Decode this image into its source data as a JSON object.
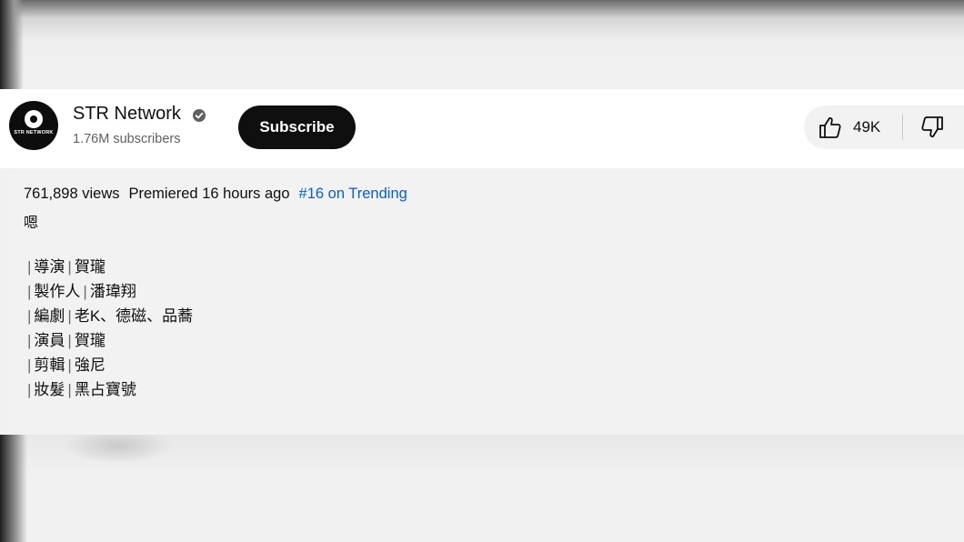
{
  "channel": {
    "name": "STR Network",
    "subscribers": "1.76M subscribers",
    "avatar_text": "STR NETWORK"
  },
  "subscribe_label": "Subscribe",
  "likes": {
    "count": "49K"
  },
  "description": {
    "views": "761,898 views",
    "premiered": "Premiered 16 hours ago",
    "trending": "#16 on Trending",
    "first_line": "嗯",
    "credits": [
      {
        "role": "導演",
        "name": "賀瓏"
      },
      {
        "role": "製作人",
        "name": "潘瑋翔"
      },
      {
        "role": "編劇",
        "name": "老K、德磁、品蕎"
      },
      {
        "role": "演員",
        "name": "賀瓏"
      },
      {
        "role": "剪輯",
        "name": "強尼"
      },
      {
        "role": "妝髮",
        "name": "黑占寶號"
      }
    ]
  },
  "colors": {
    "link": "#065fd4",
    "subscribe_bg": "#0f0f0f",
    "panel_bg": "#f2f2f2"
  },
  "icons": {
    "verified": "check-circle",
    "like": "thumbs-up-outline",
    "dislike": "thumbs-down-outline"
  }
}
